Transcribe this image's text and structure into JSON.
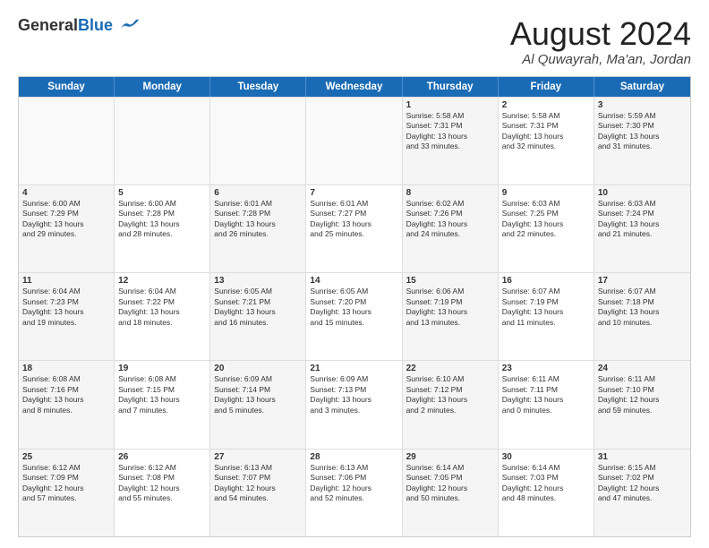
{
  "logo": {
    "general": "General",
    "blue": "Blue"
  },
  "title": "August 2024",
  "location": "Al Quwayrah, Ma'an, Jordan",
  "header_days": [
    "Sunday",
    "Monday",
    "Tuesday",
    "Wednesday",
    "Thursday",
    "Friday",
    "Saturday"
  ],
  "weeks": [
    [
      {
        "day": "",
        "text": ""
      },
      {
        "day": "",
        "text": ""
      },
      {
        "day": "",
        "text": ""
      },
      {
        "day": "",
        "text": ""
      },
      {
        "day": "1",
        "text": "Sunrise: 5:58 AM\nSunset: 7:31 PM\nDaylight: 13 hours\nand 33 minutes."
      },
      {
        "day": "2",
        "text": "Sunrise: 5:58 AM\nSunset: 7:31 PM\nDaylight: 13 hours\nand 32 minutes."
      },
      {
        "day": "3",
        "text": "Sunrise: 5:59 AM\nSunset: 7:30 PM\nDaylight: 13 hours\nand 31 minutes."
      }
    ],
    [
      {
        "day": "4",
        "text": "Sunrise: 6:00 AM\nSunset: 7:29 PM\nDaylight: 13 hours\nand 29 minutes."
      },
      {
        "day": "5",
        "text": "Sunrise: 6:00 AM\nSunset: 7:28 PM\nDaylight: 13 hours\nand 28 minutes."
      },
      {
        "day": "6",
        "text": "Sunrise: 6:01 AM\nSunset: 7:28 PM\nDaylight: 13 hours\nand 26 minutes."
      },
      {
        "day": "7",
        "text": "Sunrise: 6:01 AM\nSunset: 7:27 PM\nDaylight: 13 hours\nand 25 minutes."
      },
      {
        "day": "8",
        "text": "Sunrise: 6:02 AM\nSunset: 7:26 PM\nDaylight: 13 hours\nand 24 minutes."
      },
      {
        "day": "9",
        "text": "Sunrise: 6:03 AM\nSunset: 7:25 PM\nDaylight: 13 hours\nand 22 minutes."
      },
      {
        "day": "10",
        "text": "Sunrise: 6:03 AM\nSunset: 7:24 PM\nDaylight: 13 hours\nand 21 minutes."
      }
    ],
    [
      {
        "day": "11",
        "text": "Sunrise: 6:04 AM\nSunset: 7:23 PM\nDaylight: 13 hours\nand 19 minutes."
      },
      {
        "day": "12",
        "text": "Sunrise: 6:04 AM\nSunset: 7:22 PM\nDaylight: 13 hours\nand 18 minutes."
      },
      {
        "day": "13",
        "text": "Sunrise: 6:05 AM\nSunset: 7:21 PM\nDaylight: 13 hours\nand 16 minutes."
      },
      {
        "day": "14",
        "text": "Sunrise: 6:05 AM\nSunset: 7:20 PM\nDaylight: 13 hours\nand 15 minutes."
      },
      {
        "day": "15",
        "text": "Sunrise: 6:06 AM\nSunset: 7:19 PM\nDaylight: 13 hours\nand 13 minutes."
      },
      {
        "day": "16",
        "text": "Sunrise: 6:07 AM\nSunset: 7:19 PM\nDaylight: 13 hours\nand 11 minutes."
      },
      {
        "day": "17",
        "text": "Sunrise: 6:07 AM\nSunset: 7:18 PM\nDaylight: 13 hours\nand 10 minutes."
      }
    ],
    [
      {
        "day": "18",
        "text": "Sunrise: 6:08 AM\nSunset: 7:16 PM\nDaylight: 13 hours\nand 8 minutes."
      },
      {
        "day": "19",
        "text": "Sunrise: 6:08 AM\nSunset: 7:15 PM\nDaylight: 13 hours\nand 7 minutes."
      },
      {
        "day": "20",
        "text": "Sunrise: 6:09 AM\nSunset: 7:14 PM\nDaylight: 13 hours\nand 5 minutes."
      },
      {
        "day": "21",
        "text": "Sunrise: 6:09 AM\nSunset: 7:13 PM\nDaylight: 13 hours\nand 3 minutes."
      },
      {
        "day": "22",
        "text": "Sunrise: 6:10 AM\nSunset: 7:12 PM\nDaylight: 13 hours\nand 2 minutes."
      },
      {
        "day": "23",
        "text": "Sunrise: 6:11 AM\nSunset: 7:11 PM\nDaylight: 13 hours\nand 0 minutes."
      },
      {
        "day": "24",
        "text": "Sunrise: 6:11 AM\nSunset: 7:10 PM\nDaylight: 12 hours\nand 59 minutes."
      }
    ],
    [
      {
        "day": "25",
        "text": "Sunrise: 6:12 AM\nSunset: 7:09 PM\nDaylight: 12 hours\nand 57 minutes."
      },
      {
        "day": "26",
        "text": "Sunrise: 6:12 AM\nSunset: 7:08 PM\nDaylight: 12 hours\nand 55 minutes."
      },
      {
        "day": "27",
        "text": "Sunrise: 6:13 AM\nSunset: 7:07 PM\nDaylight: 12 hours\nand 54 minutes."
      },
      {
        "day": "28",
        "text": "Sunrise: 6:13 AM\nSunset: 7:06 PM\nDaylight: 12 hours\nand 52 minutes."
      },
      {
        "day": "29",
        "text": "Sunrise: 6:14 AM\nSunset: 7:05 PM\nDaylight: 12 hours\nand 50 minutes."
      },
      {
        "day": "30",
        "text": "Sunrise: 6:14 AM\nSunset: 7:03 PM\nDaylight: 12 hours\nand 48 minutes."
      },
      {
        "day": "31",
        "text": "Sunrise: 6:15 AM\nSunset: 7:02 PM\nDaylight: 12 hours\nand 47 minutes."
      }
    ]
  ]
}
